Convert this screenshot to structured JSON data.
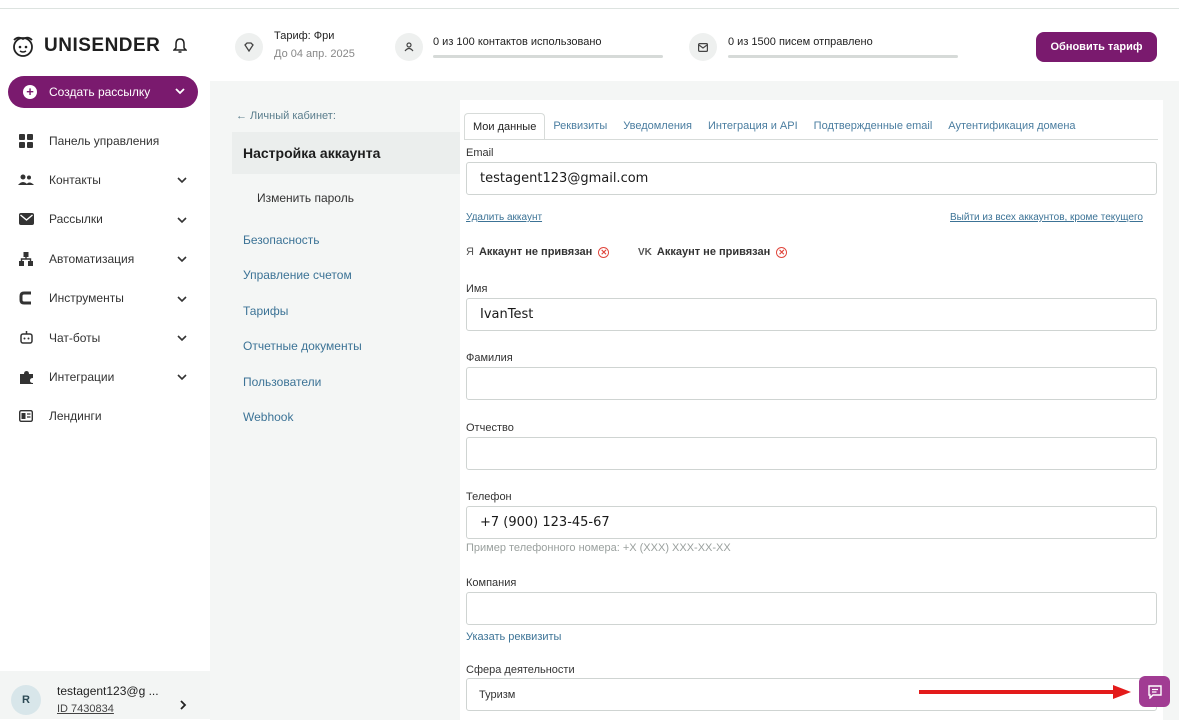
{
  "app": {
    "brand": "UNISENDER"
  },
  "colors": {
    "accent": "#7a1a6e",
    "link": "#3c7396",
    "chat": "#a13c93",
    "arrow": "#e31b1b"
  },
  "sidebar": {
    "create_label": "Создать рассылку",
    "items": [
      {
        "label": "Панель управления",
        "icon": "dashboard-icon"
      },
      {
        "label": "Контакты",
        "icon": "contacts-icon"
      },
      {
        "label": "Рассылки",
        "icon": "mail-icon"
      },
      {
        "label": "Автоматизация",
        "icon": "automation-icon"
      },
      {
        "label": "Инструменты",
        "icon": "tools-icon"
      },
      {
        "label": "Чат-боты",
        "icon": "chatbot-icon"
      },
      {
        "label": "Интеграции",
        "icon": "integrations-icon"
      },
      {
        "label": "Лендинги",
        "icon": "landing-icon"
      }
    ],
    "user": {
      "initial": "R",
      "email": "testagent123@g ...",
      "id": "ID 7430834"
    }
  },
  "topbar": {
    "tariff_title": "Тариф: Фри",
    "tariff_date": "До 04 апр. 2025",
    "contacts_usage": "0 из 100 контактов использовано",
    "emails_usage": "0 из 1500 писем отправлено",
    "upgrade_label": "Обновить тариф"
  },
  "settings_nav": {
    "back": "← Личный кабинет:",
    "title": "Настройка аккаунта",
    "items": [
      "Изменить пароль",
      "Безопасность",
      "Управление счетом",
      "Тарифы",
      "Отчетные документы",
      "Пользователи",
      "Webhook"
    ]
  },
  "tabs": [
    "Мои данные",
    "Реквизиты",
    "Уведомления",
    "Интеграция и API",
    "Подтвержденные email",
    "Аутентификация домена"
  ],
  "form": {
    "email_label": "Email",
    "email_value": "testagent123@gmail.com",
    "delete_account": "Удалить аккаунт",
    "logout_others": "Выйти из всех аккаунтов, кроме текущего",
    "yandex_symbol": "Я",
    "vk_symbol": "VK",
    "social_status": "Аккаунт не привязан",
    "name_label": "Имя",
    "name_value": "IvanTest",
    "surname_label": "Фамилия",
    "surname_value": "",
    "patronymic_label": "Отчество",
    "patronymic_value": "",
    "phone_label": "Телефон",
    "phone_value": "+7 (900) 123-45-67",
    "phone_hint": "Пример телефонного номера: +X (XXX) XXX-XX-XX",
    "company_label": "Компания",
    "company_value": "",
    "requisites_link": "Указать реквизиты",
    "sphere_label": "Сфера деятельности",
    "sphere_value": "Туризм"
  }
}
